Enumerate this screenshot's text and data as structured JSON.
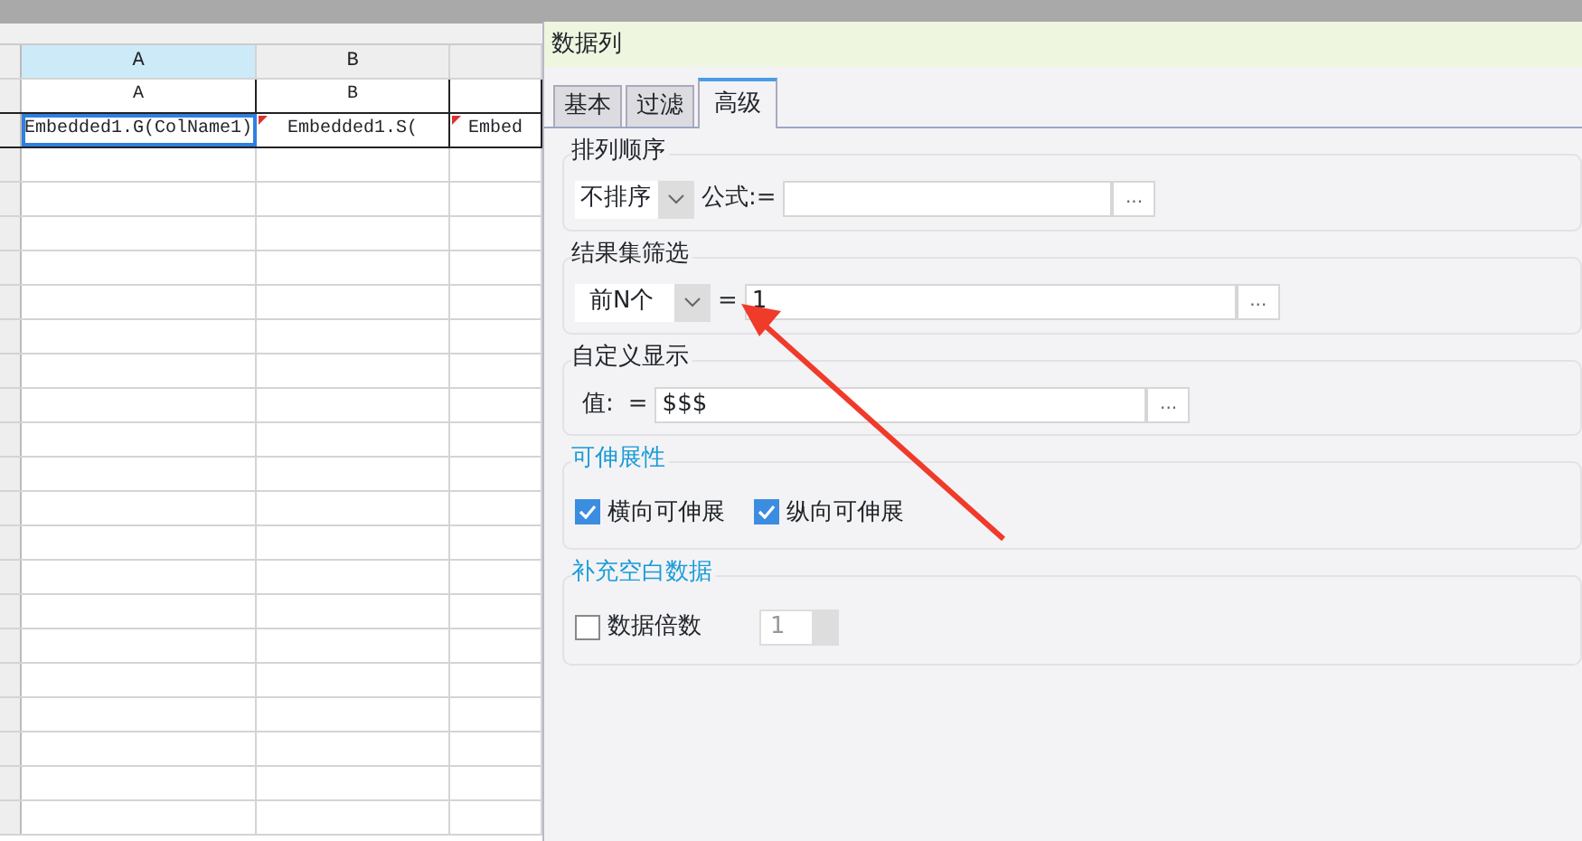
{
  "sheet": {
    "column_headers": [
      {
        "label": "A",
        "selected": true
      },
      {
        "label": "B",
        "selected": false
      },
      {
        "selected": false
      }
    ],
    "rows": [
      [
        {
          "text": "A",
          "selected": false,
          "flagged": false
        },
        {
          "text": "B",
          "selected": false,
          "flagged": false
        },
        {
          "text": "",
          "selected": false,
          "flagged": false
        }
      ],
      [
        {
          "text": "Embedded1.G(ColName1)",
          "selected": true,
          "flagged": false
        },
        {
          "text": "Embedded1.S(",
          "selected": false,
          "flagged": true
        },
        {
          "text": "Embed",
          "selected": false,
          "flagged": true
        }
      ]
    ]
  },
  "dialog": {
    "title": "数据列",
    "tabs": [
      {
        "label": "基本",
        "selected": false
      },
      {
        "label": "过滤",
        "selected": false
      },
      {
        "label": "高级",
        "selected": true
      }
    ],
    "sections": [
      {
        "title": "排列顺序",
        "accent": false,
        "kind": "sort",
        "select": "不排序",
        "label": "公式:=",
        "button": "..."
      },
      {
        "title": "结果集筛选",
        "accent": false,
        "kind": "filter",
        "select": "前N个",
        "label": "=",
        "value": "1",
        "button": "..."
      },
      {
        "title": "自定义显示",
        "accent": false,
        "kind": "display",
        "label": "值:",
        "equals": "=",
        "value": "$$$",
        "button": "..."
      },
      {
        "title": "可伸展性",
        "accent": true,
        "kind": "checks",
        "checks": [
          {
            "label": "横向可伸展",
            "checked": true
          },
          {
            "label": "纵向可伸展",
            "checked": true
          }
        ]
      },
      {
        "title": "补充空白数据",
        "accent": true,
        "kind": "fill",
        "checks": [
          {
            "label": "数据倍数",
            "checked": false
          }
        ],
        "spinner": {
          "value": "1",
          "disabled": true
        }
      }
    ]
  }
}
